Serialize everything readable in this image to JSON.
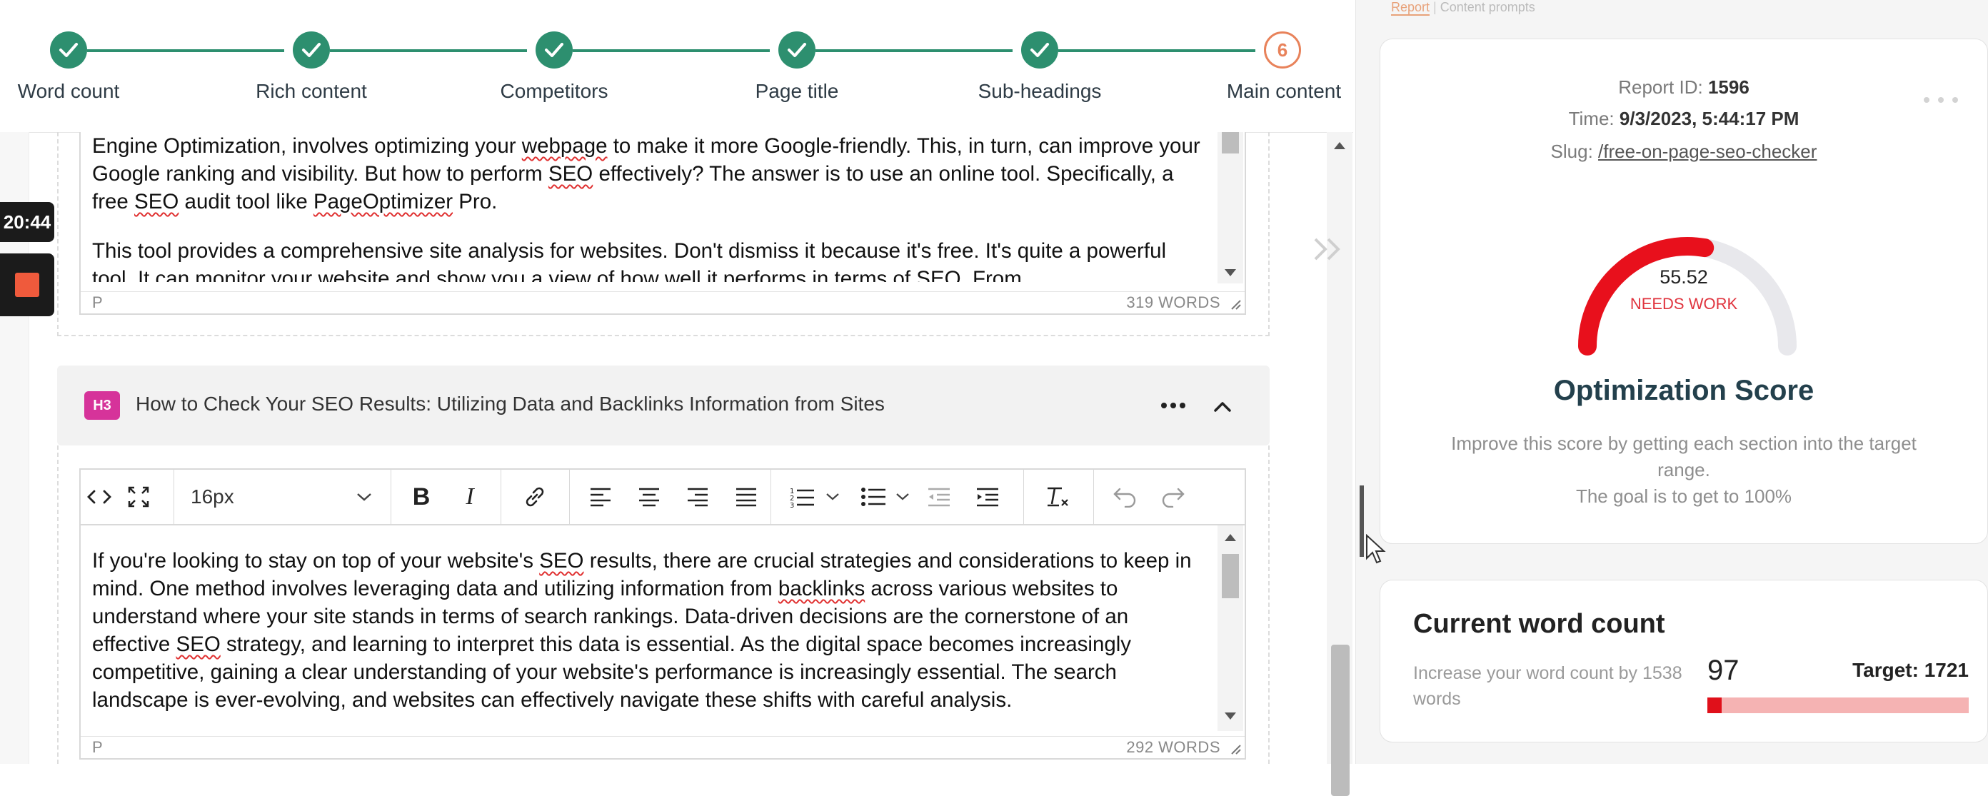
{
  "stepper": {
    "steps": [
      {
        "label": "Word count",
        "done": true
      },
      {
        "label": "Rich content",
        "done": true
      },
      {
        "label": "Competitors",
        "done": true
      },
      {
        "label": "Page title",
        "done": true
      },
      {
        "label": "Sub-headings",
        "done": true
      },
      {
        "label": "Main content",
        "done": false,
        "number": "6"
      }
    ],
    "accent": "#2d8f6f",
    "current_accent": "#e8825a"
  },
  "recorder": {
    "time": "20:44"
  },
  "editor1": {
    "para1_a": "Engine Optimization, involves optimizing your ",
    "para1_sp1": "webpage",
    "para1_b": " to make it more Google-friendly. This, in turn, can improve your Google ranking and visibility. But how to perform ",
    "para1_sp2": "SEO",
    "para1_c": " effectively? The answer is to use an online tool. Specifically, a free ",
    "para1_sp3": "SEO",
    "para1_d": " audit tool like ",
    "para1_sp4": "PageOptimizer",
    "para1_e": " Pro.",
    "para2": "This tool provides a comprehensive site analysis for websites. Don't dismiss it because it's free. It's quite a powerful tool. It can monitor your website and show you a view of how well it performs in terms of SEO. From",
    "status_tag": "P",
    "word_count": "319 WORDS"
  },
  "section2": {
    "badge": "H3",
    "title": "How to Check Your SEO Results: Utilizing Data and Backlinks Information from Sites",
    "font_size": "16px"
  },
  "editor2": {
    "t_a": "If you're looking to stay on top of your website's ",
    "t_sp1": "SEO",
    "t_b": " results, there are crucial strategies and considerations to keep in mind. One method involves leveraging data and utilizing information from ",
    "t_sp2": "backlinks",
    "t_c": " across various websites to understand where your site stands in terms of search rankings. Data-driven decisions are the cornerstone of an effective ",
    "t_sp3": "SEO",
    "t_d": " strategy, and learning to interpret this data is essential. As the digital space becomes increasingly competitive, gaining a clear understanding of your website's performance is increasingly essential. The search landscape is ever-evolving, and websites can effectively navigate these shifts with careful analysis.",
    "status_tag": "P",
    "word_count": "292 WORDS"
  },
  "right_panel": {
    "tabs": [
      "Report",
      "Content prompts"
    ],
    "report": {
      "id_label": "Report ID:",
      "id_value": "1596",
      "time_label": "Time:",
      "time_value": "9/3/2023, 5:44:17 PM",
      "slug_label": "Slug:",
      "slug_value": "/free-on-page-seo-checker"
    },
    "score": {
      "value": "55.52",
      "value_fraction": 0.5552,
      "status": "NEEDS WORK",
      "title": "Optimization Score",
      "desc": "Improve this score by getting each section into the target range.",
      "goal": "The goal is to get to 100%",
      "gauge_color": "#e8101c",
      "track_color": "#e8e8ec"
    },
    "word_count": {
      "title": "Current word count",
      "desc": "Increase your word count by 1538 words",
      "current": "97",
      "target_label": "Target: 1721",
      "progress_fraction": 0.056
    }
  }
}
